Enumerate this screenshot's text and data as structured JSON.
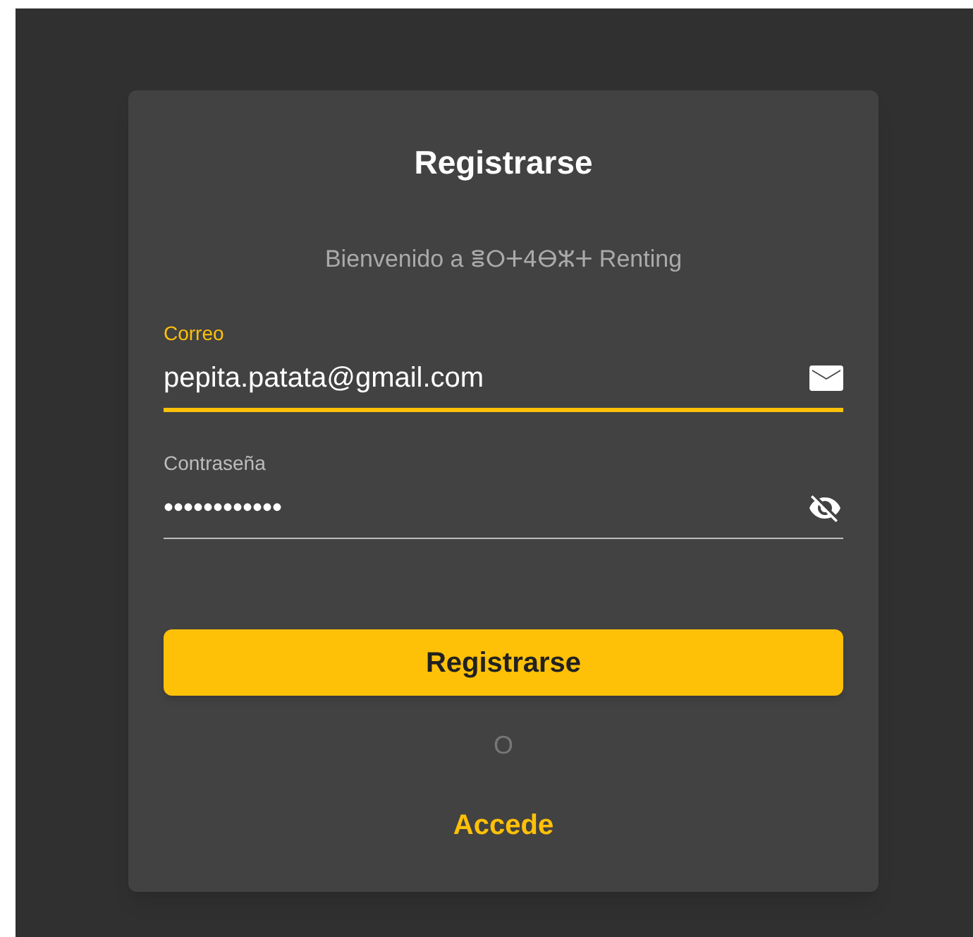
{
  "title": "Registrarse",
  "subtitle": {
    "before": "Bienvenido a",
    "brand": "ⴻⵔⵜ4ⴱⵣⵜ",
    "after": "Renting"
  },
  "fields": [
    {
      "label": "Correo",
      "value": "pepita.patata@gmail.com",
      "focused": true,
      "kind": "email"
    },
    {
      "label": "Contraseña",
      "value": "••••••••••••",
      "focused": false,
      "kind": "password"
    }
  ],
  "submit": "Registrarse",
  "separator": "O",
  "link": "Accede"
}
